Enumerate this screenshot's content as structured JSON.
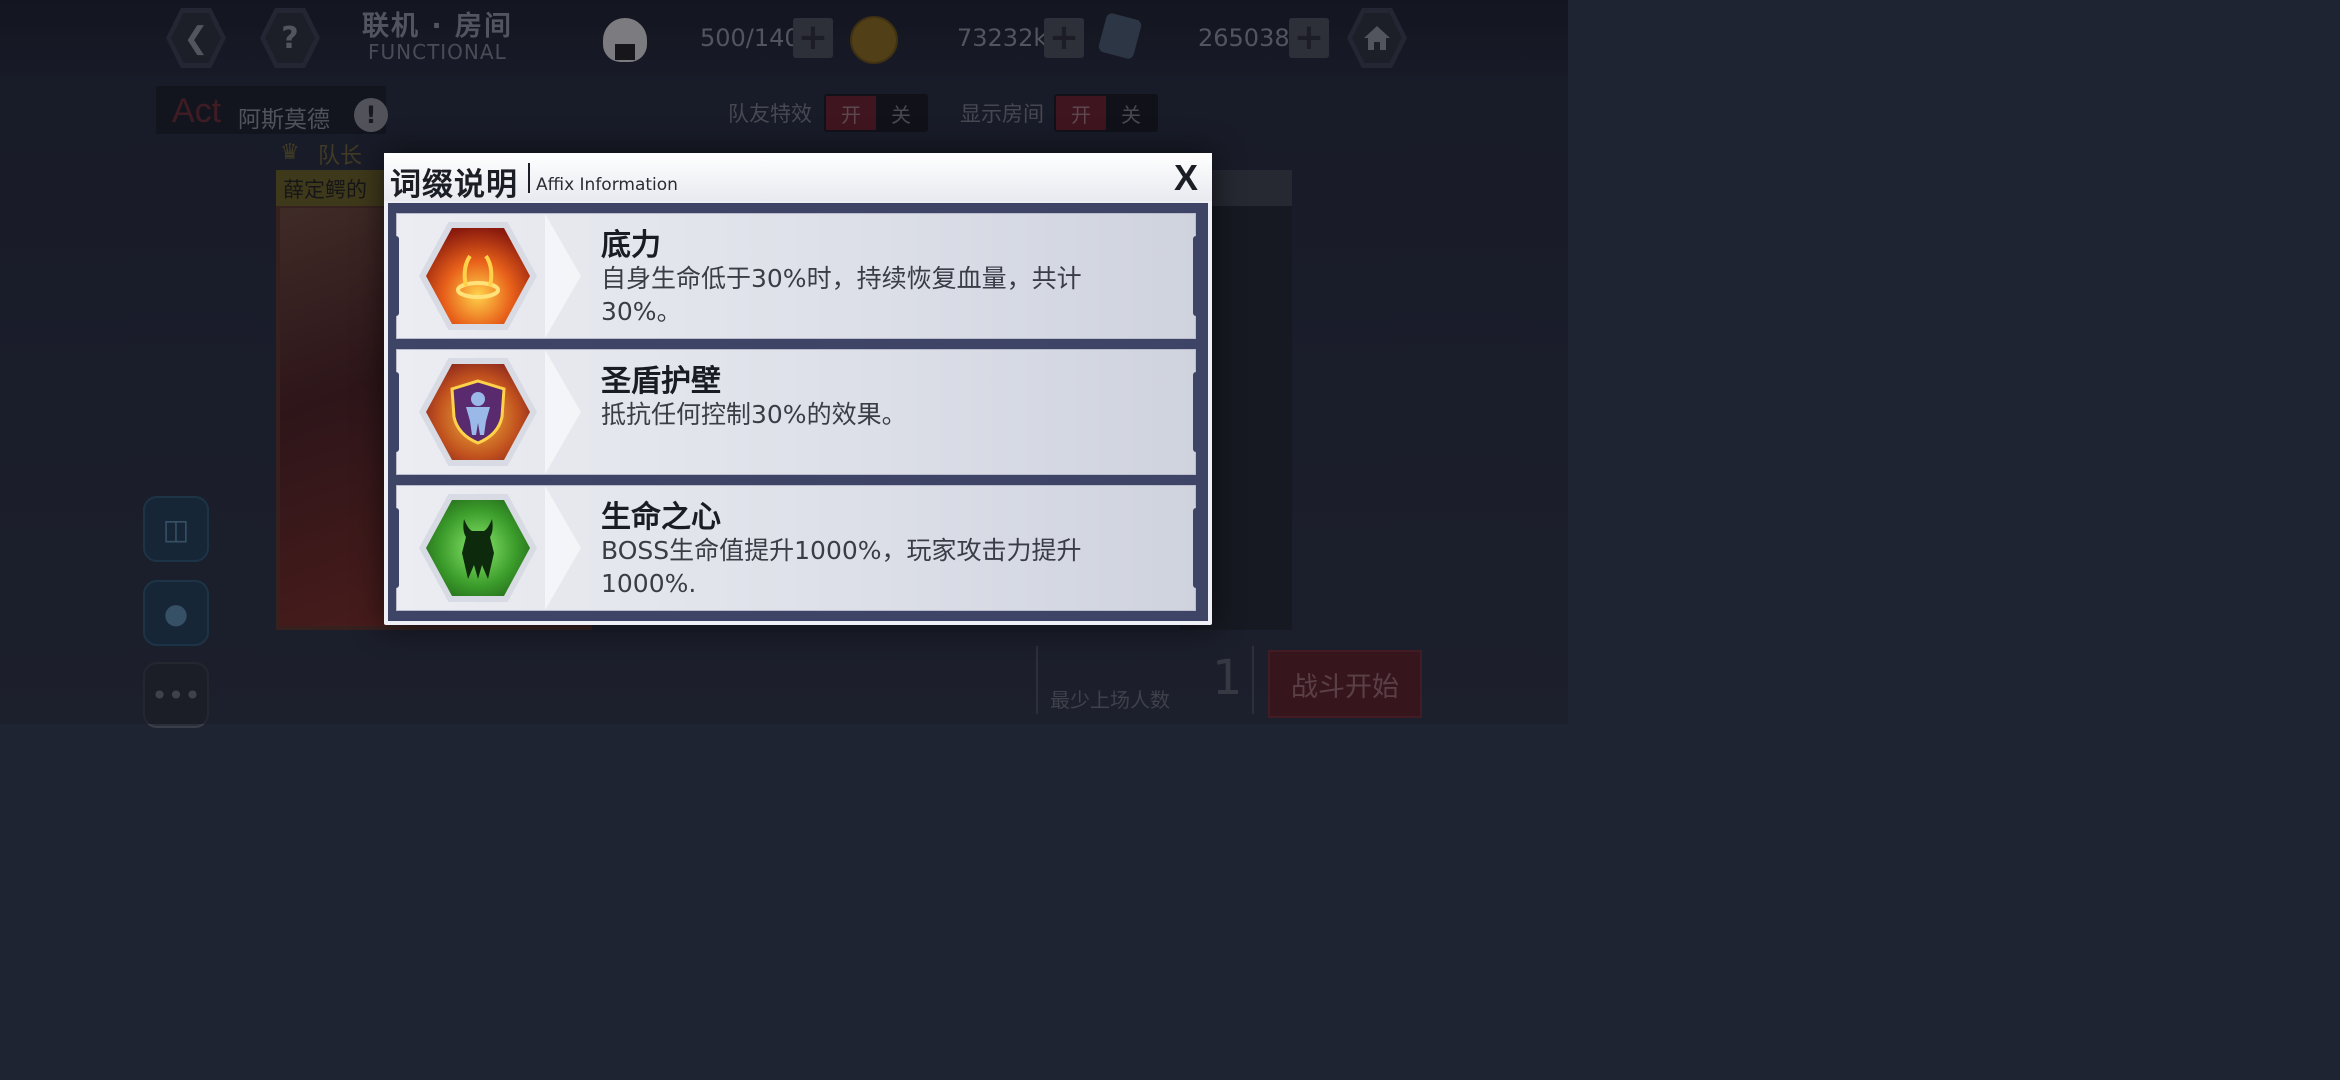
{
  "topbar": {
    "title_cn": "联机 · 房间",
    "title_en": "FUNCTIONAL",
    "stamina": "500/140",
    "coins": "73232k",
    "crystals": "265038"
  },
  "room": {
    "act_label": "Act",
    "act_name": "阿斯莫德",
    "leader_label": "队长",
    "leader_name": "薛定鳄的",
    "toggle_teammate_label": "队友特效",
    "toggle_room_label": "显示房间",
    "on_label": "开",
    "off_label": "关",
    "min_players_label": "最少上场人数",
    "min_players_value": "1",
    "start_label": "战斗开始"
  },
  "modal": {
    "title_cn": "词缀说明",
    "title_en": "Affix Information",
    "close_label": "X",
    "affixes": [
      {
        "name": "底力",
        "desc": "自身生命低于30%时，持续恢复血量，共计30%。",
        "icon": "flame-icon"
      },
      {
        "name": "圣盾护壁",
        "desc": "抵抗任何控制30%的效果。",
        "icon": "shield-figure-icon"
      },
      {
        "name": "生命之心",
        "desc": "BOSS生命值提升1000%，玩家攻击力提升1000%.",
        "icon": "horned-silhouette-icon"
      }
    ]
  },
  "colors": {
    "modal_body": "#3d4466",
    "toggle_on": "#6a1e28",
    "start_button": "#5a1e26"
  }
}
